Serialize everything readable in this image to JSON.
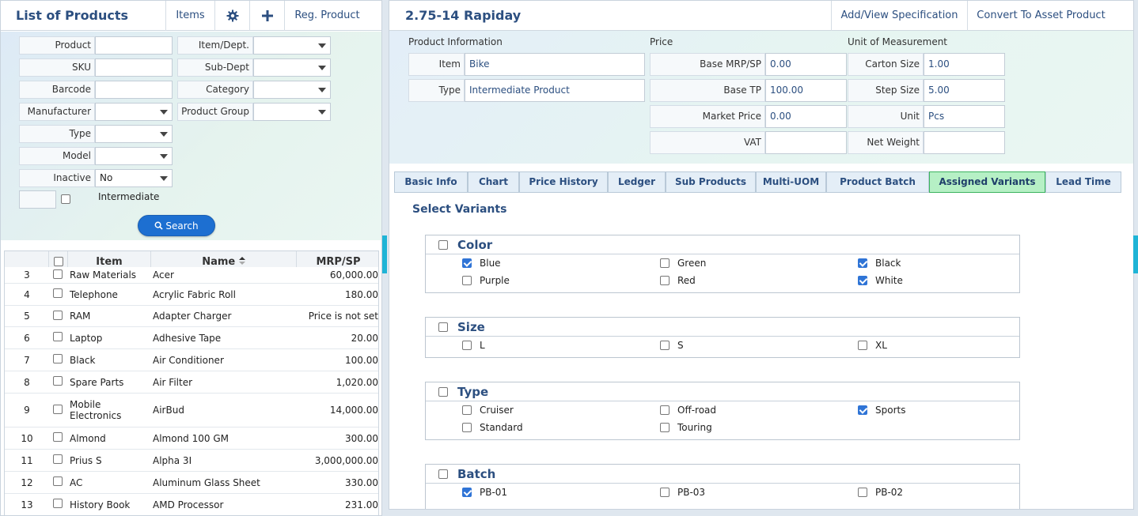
{
  "left": {
    "title": "List of Products",
    "header_buttons": {
      "items": "Items",
      "reg_product": "Reg. Product"
    },
    "filters": {
      "product": "Product",
      "sku": "SKU",
      "barcode": "Barcode",
      "manufacturer": "Manufacturer",
      "type": "Type",
      "model": "Model",
      "inactive": "Inactive",
      "inactive_value": "No",
      "item_dept": "Item/Dept.",
      "sub_dept": "Sub-Dept",
      "category": "Category",
      "product_group": "Product Group",
      "intermediate": "Intermediate"
    },
    "search_label": "Search",
    "table": {
      "columns": {
        "item": "Item",
        "name": "Name",
        "mrp": "MRP/SP"
      },
      "rows": [
        {
          "n": "3",
          "item": "Raw Materials",
          "name": "Acer",
          "mrp": "60,000.00"
        },
        {
          "n": "4",
          "item": "Telephone",
          "name": "Acrylic Fabric Roll",
          "mrp": "180.00"
        },
        {
          "n": "5",
          "item": "RAM",
          "name": "Adapter Charger",
          "mrp": "Price is not set"
        },
        {
          "n": "6",
          "item": "Laptop",
          "name": "Adhesive Tape",
          "mrp": "20.00"
        },
        {
          "n": "7",
          "item": "Black",
          "name": "Air Conditioner",
          "mrp": "100.00"
        },
        {
          "n": "8",
          "item": "Spare Parts",
          "name": "Air Filter",
          "mrp": "1,020.00"
        },
        {
          "n": "9",
          "item": "Mobile Electronics",
          "name": "AirBud",
          "mrp": "14,000.00"
        },
        {
          "n": "10",
          "item": "Almond",
          "name": "Almond 100 GM",
          "mrp": "300.00"
        },
        {
          "n": "11",
          "item": "Prius S",
          "name": "Alpha 3I",
          "mrp": "3,000,000.00"
        },
        {
          "n": "12",
          "item": "AC",
          "name": "Aluminum Glass Sheet",
          "mrp": "330.00"
        },
        {
          "n": "13",
          "item": "History Book",
          "name": "AMD Processor",
          "mrp": "231.00"
        }
      ]
    }
  },
  "right": {
    "title": "2.75-14 Rapiday",
    "header_buttons": {
      "spec": "Add/View Specification",
      "convert": "Convert To Asset Product"
    },
    "sections": {
      "product_info": "Product Information",
      "price": "Price",
      "uom": "Unit of Measurement"
    },
    "product_info": {
      "item_label": "Item",
      "item_value": "Bike",
      "type_label": "Type",
      "type_value": "Intermediate Product"
    },
    "price": {
      "base_mrp_label": "Base MRP/SP",
      "base_mrp_value": "0.00",
      "base_tp_label": "Base TP",
      "base_tp_value": "100.00",
      "market_label": "Market Price",
      "market_value": "0.00",
      "vat_label": "VAT",
      "vat_value": ""
    },
    "uom": {
      "carton_label": "Carton Size",
      "carton_value": "1.00",
      "step_label": "Step Size",
      "step_value": "5.00",
      "unit_label": "Unit",
      "unit_value": "Pcs",
      "net_weight_label": "Net Weight",
      "net_weight_value": ""
    },
    "tabs": [
      "Basic Info",
      "Chart",
      "Price History",
      "Ledger",
      "Sub Products",
      "Multi-UOM",
      "Product Batch",
      "Assigned Variants",
      "Lead Time"
    ],
    "active_tab": "Assigned Variants",
    "variants_title": "Select Variants",
    "groups": [
      {
        "name": "Color",
        "options": [
          {
            "label": "Blue",
            "checked": true
          },
          {
            "label": "Green",
            "checked": false
          },
          {
            "label": "Black",
            "checked": true
          },
          {
            "label": "Purple",
            "checked": false
          },
          {
            "label": "Red",
            "checked": false
          },
          {
            "label": "White",
            "checked": true
          }
        ]
      },
      {
        "name": "Size",
        "options": [
          {
            "label": "L",
            "checked": false
          },
          {
            "label": "S",
            "checked": false
          },
          {
            "label": "XL",
            "checked": false
          }
        ]
      },
      {
        "name": "Type",
        "options": [
          {
            "label": "Cruiser",
            "checked": false
          },
          {
            "label": "Off-road",
            "checked": false
          },
          {
            "label": "Sports",
            "checked": true
          },
          {
            "label": "Standard",
            "checked": false
          },
          {
            "label": "Touring",
            "checked": false
          }
        ]
      },
      {
        "name": "Batch",
        "options": [
          {
            "label": "PB-01",
            "checked": true
          },
          {
            "label": "PB-03",
            "checked": false
          },
          {
            "label": "PB-02",
            "checked": false
          }
        ]
      }
    ]
  },
  "colors": {
    "accent": "#2c4f80",
    "button": "#1d6fd1",
    "active_tab": "#b6f0c5",
    "splitter": "#1fb4d6"
  }
}
